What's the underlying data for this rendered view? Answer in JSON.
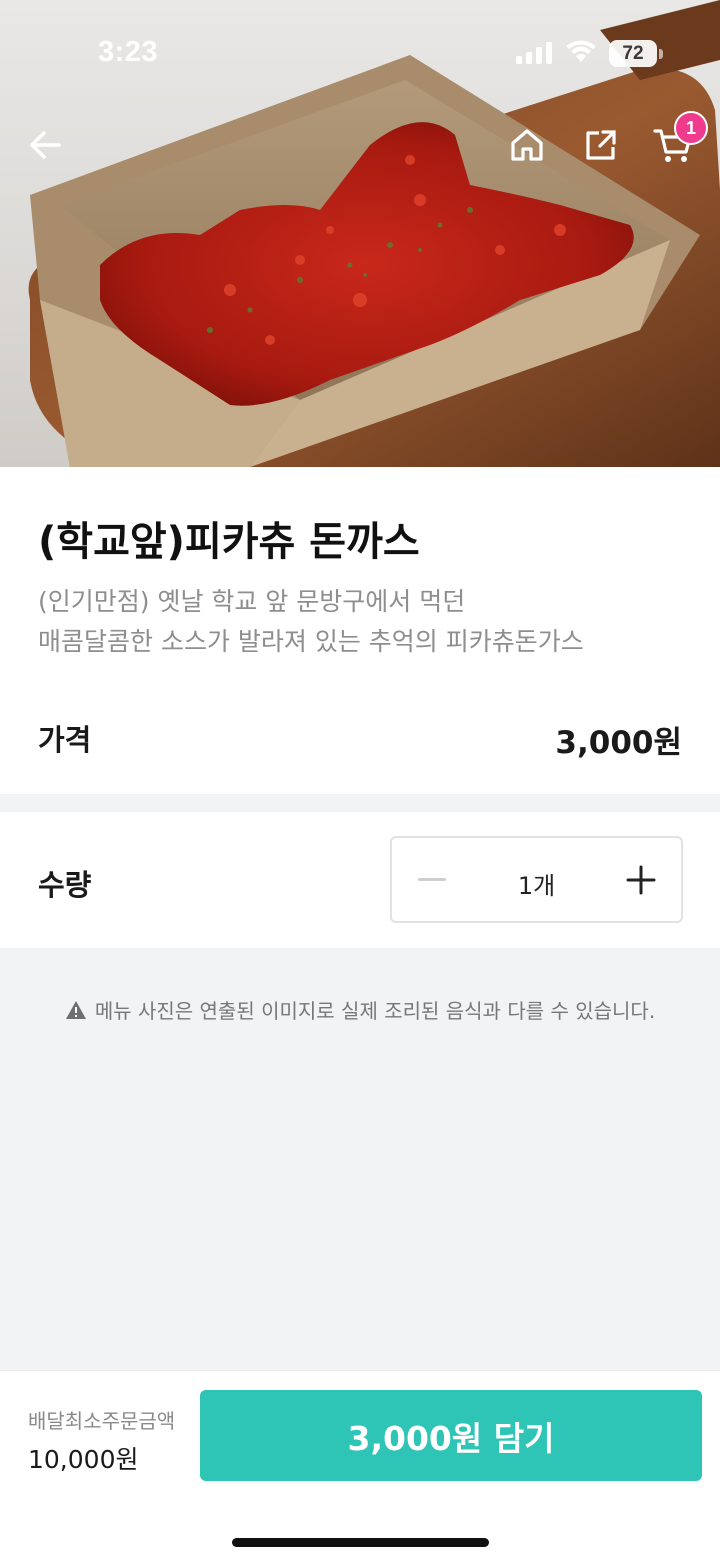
{
  "status_bar": {
    "time": "3:23",
    "battery": "72"
  },
  "header": {
    "cart_count": "1"
  },
  "product": {
    "title": "(학교앞)피카츄 돈까스",
    "description_line1": "(인기만점) 옛날 학교 앞 문방구에서 먹던",
    "description_line2": "매콤달콤한 소스가 발라져 있는 추억의 피카츄돈가스",
    "price_label": "가격",
    "price_value": "3,000원"
  },
  "quantity": {
    "label": "수량",
    "value": "1개"
  },
  "notice": "메뉴 사진은 연출된 이미지로 실제 조리된 음식과 다를 수 있습니다.",
  "bottom": {
    "min_order_label": "배달최소주문금액",
    "min_order_value": "10,000원",
    "add_button": "3,000원 담기"
  },
  "colors": {
    "accent": "#2ec4b6",
    "badge": "#ef3a8e"
  },
  "icons": [
    "back-arrow-icon",
    "home-icon",
    "share-icon",
    "cart-icon",
    "minus-icon",
    "plus-icon",
    "warning-icon",
    "signal-icon",
    "wifi-icon",
    "battery-icon"
  ]
}
